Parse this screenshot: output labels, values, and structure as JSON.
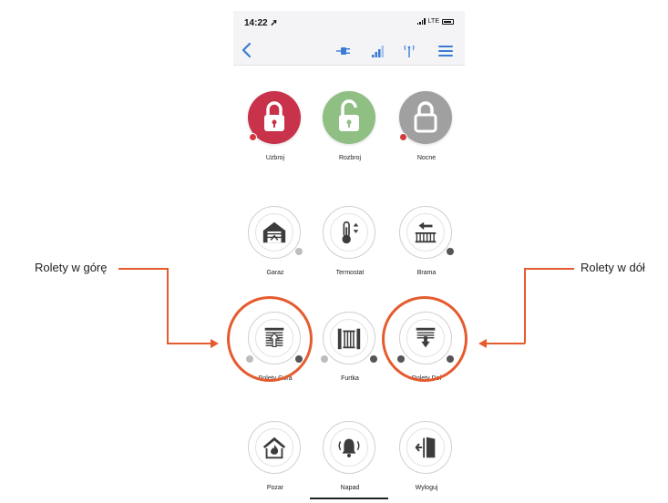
{
  "status_bar": {
    "time": "14:22",
    "network": "LTE"
  },
  "navbar": {
    "icons": [
      "back-chevron-icon",
      "plug-icon",
      "signal-strength-icon",
      "antenna-icon",
      "menu-icon"
    ],
    "accent_color": "#3a7bd5"
  },
  "tiles": [
    {
      "id": "uzbroj",
      "label": "Uzbroj",
      "icon": "padlock-icon",
      "color": "#c8324a"
    },
    {
      "id": "rozbroj",
      "label": "Rozbroj",
      "icon": "padlock-icon",
      "color": "#8fbf83"
    },
    {
      "id": "nocne",
      "label": "Nocne",
      "icon": "padlock-icon",
      "color": "#a0a0a0"
    },
    {
      "id": "garaz",
      "label": "Garaz",
      "icon": "garage-icon"
    },
    {
      "id": "termostat",
      "label": "Termostat",
      "icon": "thermometer-icon"
    },
    {
      "id": "brama",
      "label": "Brama",
      "icon": "gate-icon"
    },
    {
      "id": "rolety_gora",
      "label": "Rolety Gora",
      "icon": "blinds-up-icon"
    },
    {
      "id": "furtka",
      "label": "Furtka",
      "icon": "wicket-icon"
    },
    {
      "id": "rolety_dol",
      "label": "Rolety Dol",
      "icon": "blinds-down-icon"
    },
    {
      "id": "pozar",
      "label": "Pozar",
      "icon": "fire-house-icon"
    },
    {
      "id": "napad",
      "label": "Napad",
      "icon": "bell-icon"
    },
    {
      "id": "wyloguj",
      "label": "Wyloguj",
      "icon": "logout-door-icon"
    }
  ],
  "annotations": {
    "left_label": "Rolety w górę",
    "right_label": "Rolety w dół",
    "highlight_color": "#e55b2e"
  }
}
